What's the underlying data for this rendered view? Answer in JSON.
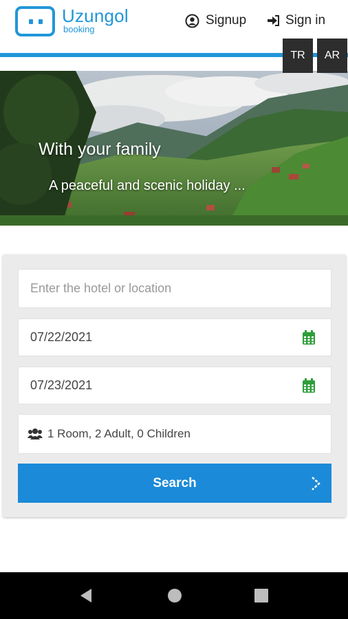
{
  "brand": {
    "name": "Uzungol",
    "tagline": "booking",
    "color": "#2196d9"
  },
  "header": {
    "signup_label": "Signup",
    "signin_label": "Sign in",
    "languages": [
      "TR",
      "AR"
    ]
  },
  "hero": {
    "title": "With your family",
    "subtitle": "A peaceful and scenic holiday ..."
  },
  "search_form": {
    "location_placeholder": "Enter the hotel or location",
    "checkin_date": "07/22/2021",
    "checkout_date": "07/23/2021",
    "guests_summary": "1 Room, 2 Adult, 0 Children",
    "search_label": "Search",
    "icons": {
      "date": "calendar-icon",
      "guests": "users-icon",
      "submit": "chevron-right-icon"
    },
    "accent_color": "#1b8ad8",
    "calendar_color": "#2e9e3a"
  },
  "system_nav": {
    "buttons": [
      "back-icon",
      "home-icon",
      "recents-icon"
    ]
  }
}
